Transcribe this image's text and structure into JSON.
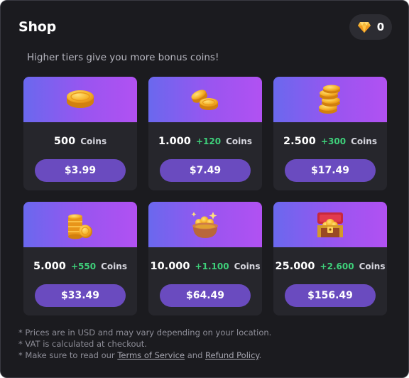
{
  "header": {
    "title": "Shop",
    "gem_count": "0"
  },
  "subtitle": "Higher tiers give you more bonus coins!",
  "packages": [
    {
      "amount": "500",
      "bonus": "",
      "unit": "Coins",
      "price": "$3.99",
      "icon": "single-coin-icon"
    },
    {
      "amount": "1.000",
      "bonus": "+120",
      "unit": "Coins",
      "price": "$7.49",
      "icon": "coin-pair-icon"
    },
    {
      "amount": "2.500",
      "bonus": "+300",
      "unit": "Coins",
      "price": "$17.49",
      "icon": "coin-stack-icon"
    },
    {
      "amount": "5.000",
      "bonus": "+550",
      "unit": "Coins",
      "price": "$33.49",
      "icon": "coin-tower-icon"
    },
    {
      "amount": "10.000",
      "bonus": "+1.100",
      "unit": "Coins",
      "price": "$64.49",
      "icon": "coin-pot-icon"
    },
    {
      "amount": "25.000",
      "bonus": "+2.600",
      "unit": "Coins",
      "price": "$156.49",
      "icon": "treasure-chest-icon"
    }
  ],
  "notes": {
    "line1": "* Prices are in USD and may vary depending on your location.",
    "line2": "* VAT is calculated at checkout.",
    "line3_prefix": "* Make sure to read our ",
    "terms_link": "Terms of Service",
    "line3_and": " and ",
    "refund_link": "Refund Policy",
    "line3_suffix": "."
  },
  "colors": {
    "background": "#1b1b1f",
    "card": "#26262c",
    "price_button": "#6a4bbf",
    "bonus": "#3ed07a",
    "banner_start": "#6a68ee",
    "banner_end": "#b151f2",
    "gem": "#f5b93a"
  }
}
